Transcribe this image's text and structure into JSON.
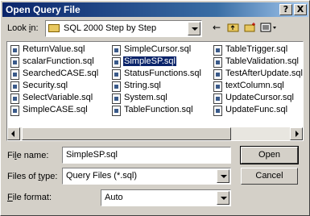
{
  "window": {
    "title": "Open Query File"
  },
  "titlebar": {
    "help_label": "?",
    "close_label": "X"
  },
  "look_in": {
    "label_pre": "Look ",
    "label_key": "i",
    "label_post": "n:",
    "value": "SQL 2000 Step by Step"
  },
  "toolbar": {
    "back_icon": "back-arrow-icon",
    "up_icon": "up-folder-icon",
    "new_folder_icon": "new-folder-icon",
    "views_icon": "views-menu-icon"
  },
  "files": {
    "col1": [
      "ReturnValue.sql",
      "scalarFunction.sql",
      "SearchedCASE.sql",
      "Security.sql",
      "SelectVariable.sql",
      "SimpleCASE.sql"
    ],
    "col2": [
      "SimpleCursor.sql",
      "SimpleSP.sql",
      "StatusFunctions.sql",
      "String.sql",
      "System.sql",
      "TableFunction.sql"
    ],
    "col3": [
      "TableTrigger.sql",
      "TableValidation.sql",
      "TestAfterUpdate.sql",
      "textColumn.sql",
      "UpdateCursor.sql",
      "UpdateFunc.sql"
    ],
    "selected": "SimpleSP.sql"
  },
  "file_name": {
    "label_pre": "Fi",
    "label_key": "l",
    "label_post": "e name:",
    "value": "SimpleSP.sql"
  },
  "files_of_type": {
    "label_pre": "Files of ",
    "label_key": "t",
    "label_post": "ype:",
    "value": "Query Files (*.sql)"
  },
  "file_format": {
    "label_pre": "",
    "label_key": "F",
    "label_post": "ile format:",
    "value": "Auto"
  },
  "buttons": {
    "open": "Open",
    "cancel": "Cancel"
  }
}
